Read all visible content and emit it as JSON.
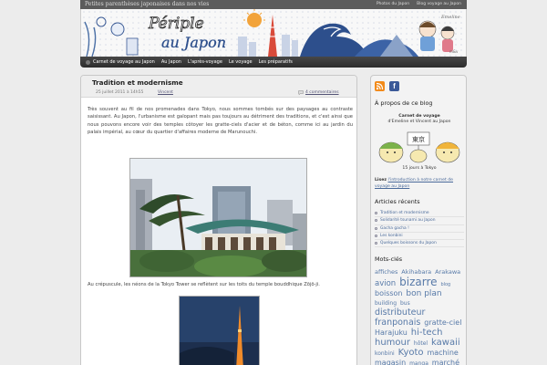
{
  "header": {
    "tagline": "Petites parenthèses japonaises dans nos vies",
    "toplinks": [
      "Photos du Japon",
      "Blog voyage au Japon"
    ],
    "logo_text": [
      "Périple",
      "au Japon"
    ]
  },
  "nav": {
    "items": [
      "Carnet de voyage au Japon",
      "Au Japon",
      "L'après-voyage",
      "Le voyage",
      "Les préparatifs"
    ]
  },
  "post": {
    "title": "Tradition et modernisme",
    "date": "25 juillet 2011 à 14h55",
    "author": "Vincent",
    "comments": "4 commentaires",
    "body": "Très souvent au fil de nos promenades dans Tokyo, nous sommes tombés sur des paysages au contraste saisissant. Au Japon, l'urbanisme est galopant mais pas toujours au détriment des traditions, et c'est ainsi que nous pouvons encore voir des temples côtoyer les gratte-ciels d'acier et de béton, comme ici au jardin du palais impérial, au cœur du quartier d'affaires moderne de Marunouchi.",
    "caption": "Au crépuscule, les néons de la Tokyo Tower se reflètent sur les toits du temple bouddhique Zōjō-ji."
  },
  "sidebar": {
    "about_title": "À propos de ce blog",
    "carnet_title": "Carnet de voyage",
    "carnet_sub": "d'Emeline et Vincent au Japon",
    "mascot_sign": "東京",
    "days": "15 jours à Tokyo",
    "read_label": "Lisez",
    "read_link": "l'introduction à notre carnet de voyage au Japon",
    "recent_title": "Articles récents",
    "recent": [
      "Tradition et modernisme",
      "Solidarité tsunami au Japon",
      "Gacha gacha !",
      "Les konbini",
      "Quelques boissons du Japon"
    ],
    "tags_title": "Mots-clés",
    "tags": [
      {
        "t": "affiches",
        "s": 6.5
      },
      {
        "t": "Akihabara",
        "s": 6.5
      },
      {
        "t": "Arakawa",
        "s": 6.5
      },
      {
        "t": "avion",
        "s": 8.5
      },
      {
        "t": "bizarre",
        "s": 12
      },
      {
        "t": "blog",
        "s": 5
      },
      {
        "t": "boisson",
        "s": 8
      },
      {
        "t": "bon plan",
        "s": 9
      },
      {
        "t": "building",
        "s": 6
      },
      {
        "t": "bus",
        "s": 6
      },
      {
        "t": "distributeur",
        "s": 9.5
      },
      {
        "t": "franponais",
        "s": 9.5
      },
      {
        "t": "gratte-ciel",
        "s": 8
      },
      {
        "t": "Harajuku",
        "s": 8
      },
      {
        "t": "hi-tech",
        "s": 10
      },
      {
        "t": "humour",
        "s": 10
      },
      {
        "t": "hôtel",
        "s": 6
      },
      {
        "t": "kawaii",
        "s": 10
      },
      {
        "t": "konbini",
        "s": 6
      },
      {
        "t": "Kyoto",
        "s": 10
      },
      {
        "t": "machine",
        "s": 8
      },
      {
        "t": "magasin",
        "s": 8
      },
      {
        "t": "manga",
        "s": 6
      },
      {
        "t": "marché",
        "s": 8
      }
    ]
  },
  "colors": {
    "topbar": "#5c5c5c",
    "nav": "#3a3a3a",
    "link": "#4a6a9a",
    "tag": "#587aa8",
    "rss": "#f28a1a",
    "facebook": "#3b5998"
  }
}
